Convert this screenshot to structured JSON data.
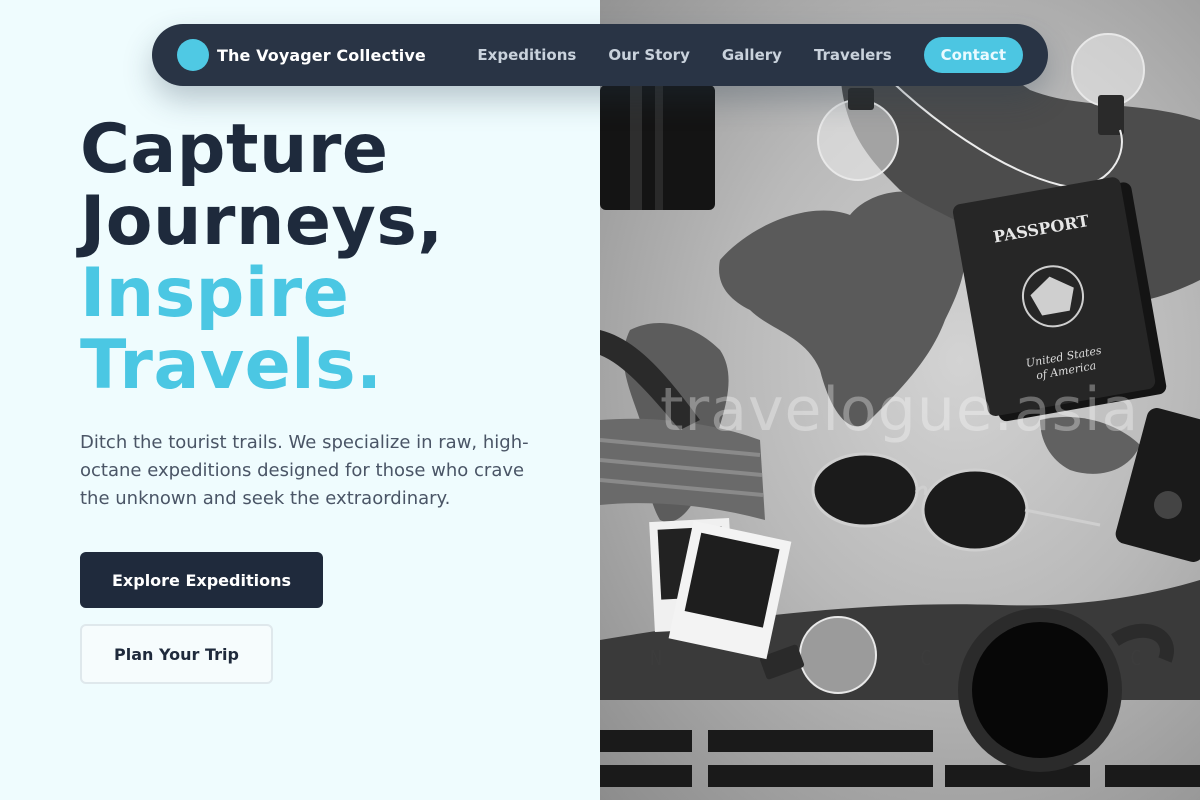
{
  "nav": {
    "brand": "The Voyager Collective",
    "links": [
      "Expeditions",
      "Our Story",
      "Gallery",
      "Travelers"
    ],
    "contact": "Contact"
  },
  "hero": {
    "headline_line1": "Capture",
    "headline_line2": "Journeys,",
    "headline_accent1": "Inspire",
    "headline_accent2": "Travels.",
    "description": "Ditch the tourist trails. We specialize in raw, high-octane expeditions designed for those who crave the unknown and seek the extraordinary.",
    "primary_cta": "Explore Expeditions",
    "secondary_cta": "Plan Your Trip"
  },
  "photo": {
    "watermark": "travelogue.asia",
    "passport_title": "PASSPORT",
    "passport_country_line1": "United States",
    "passport_country_line2": "of America"
  },
  "colors": {
    "dark": "#1e2a3c",
    "accent": "#4bc7e3",
    "background": "#effcfe",
    "nav": "#293445"
  }
}
